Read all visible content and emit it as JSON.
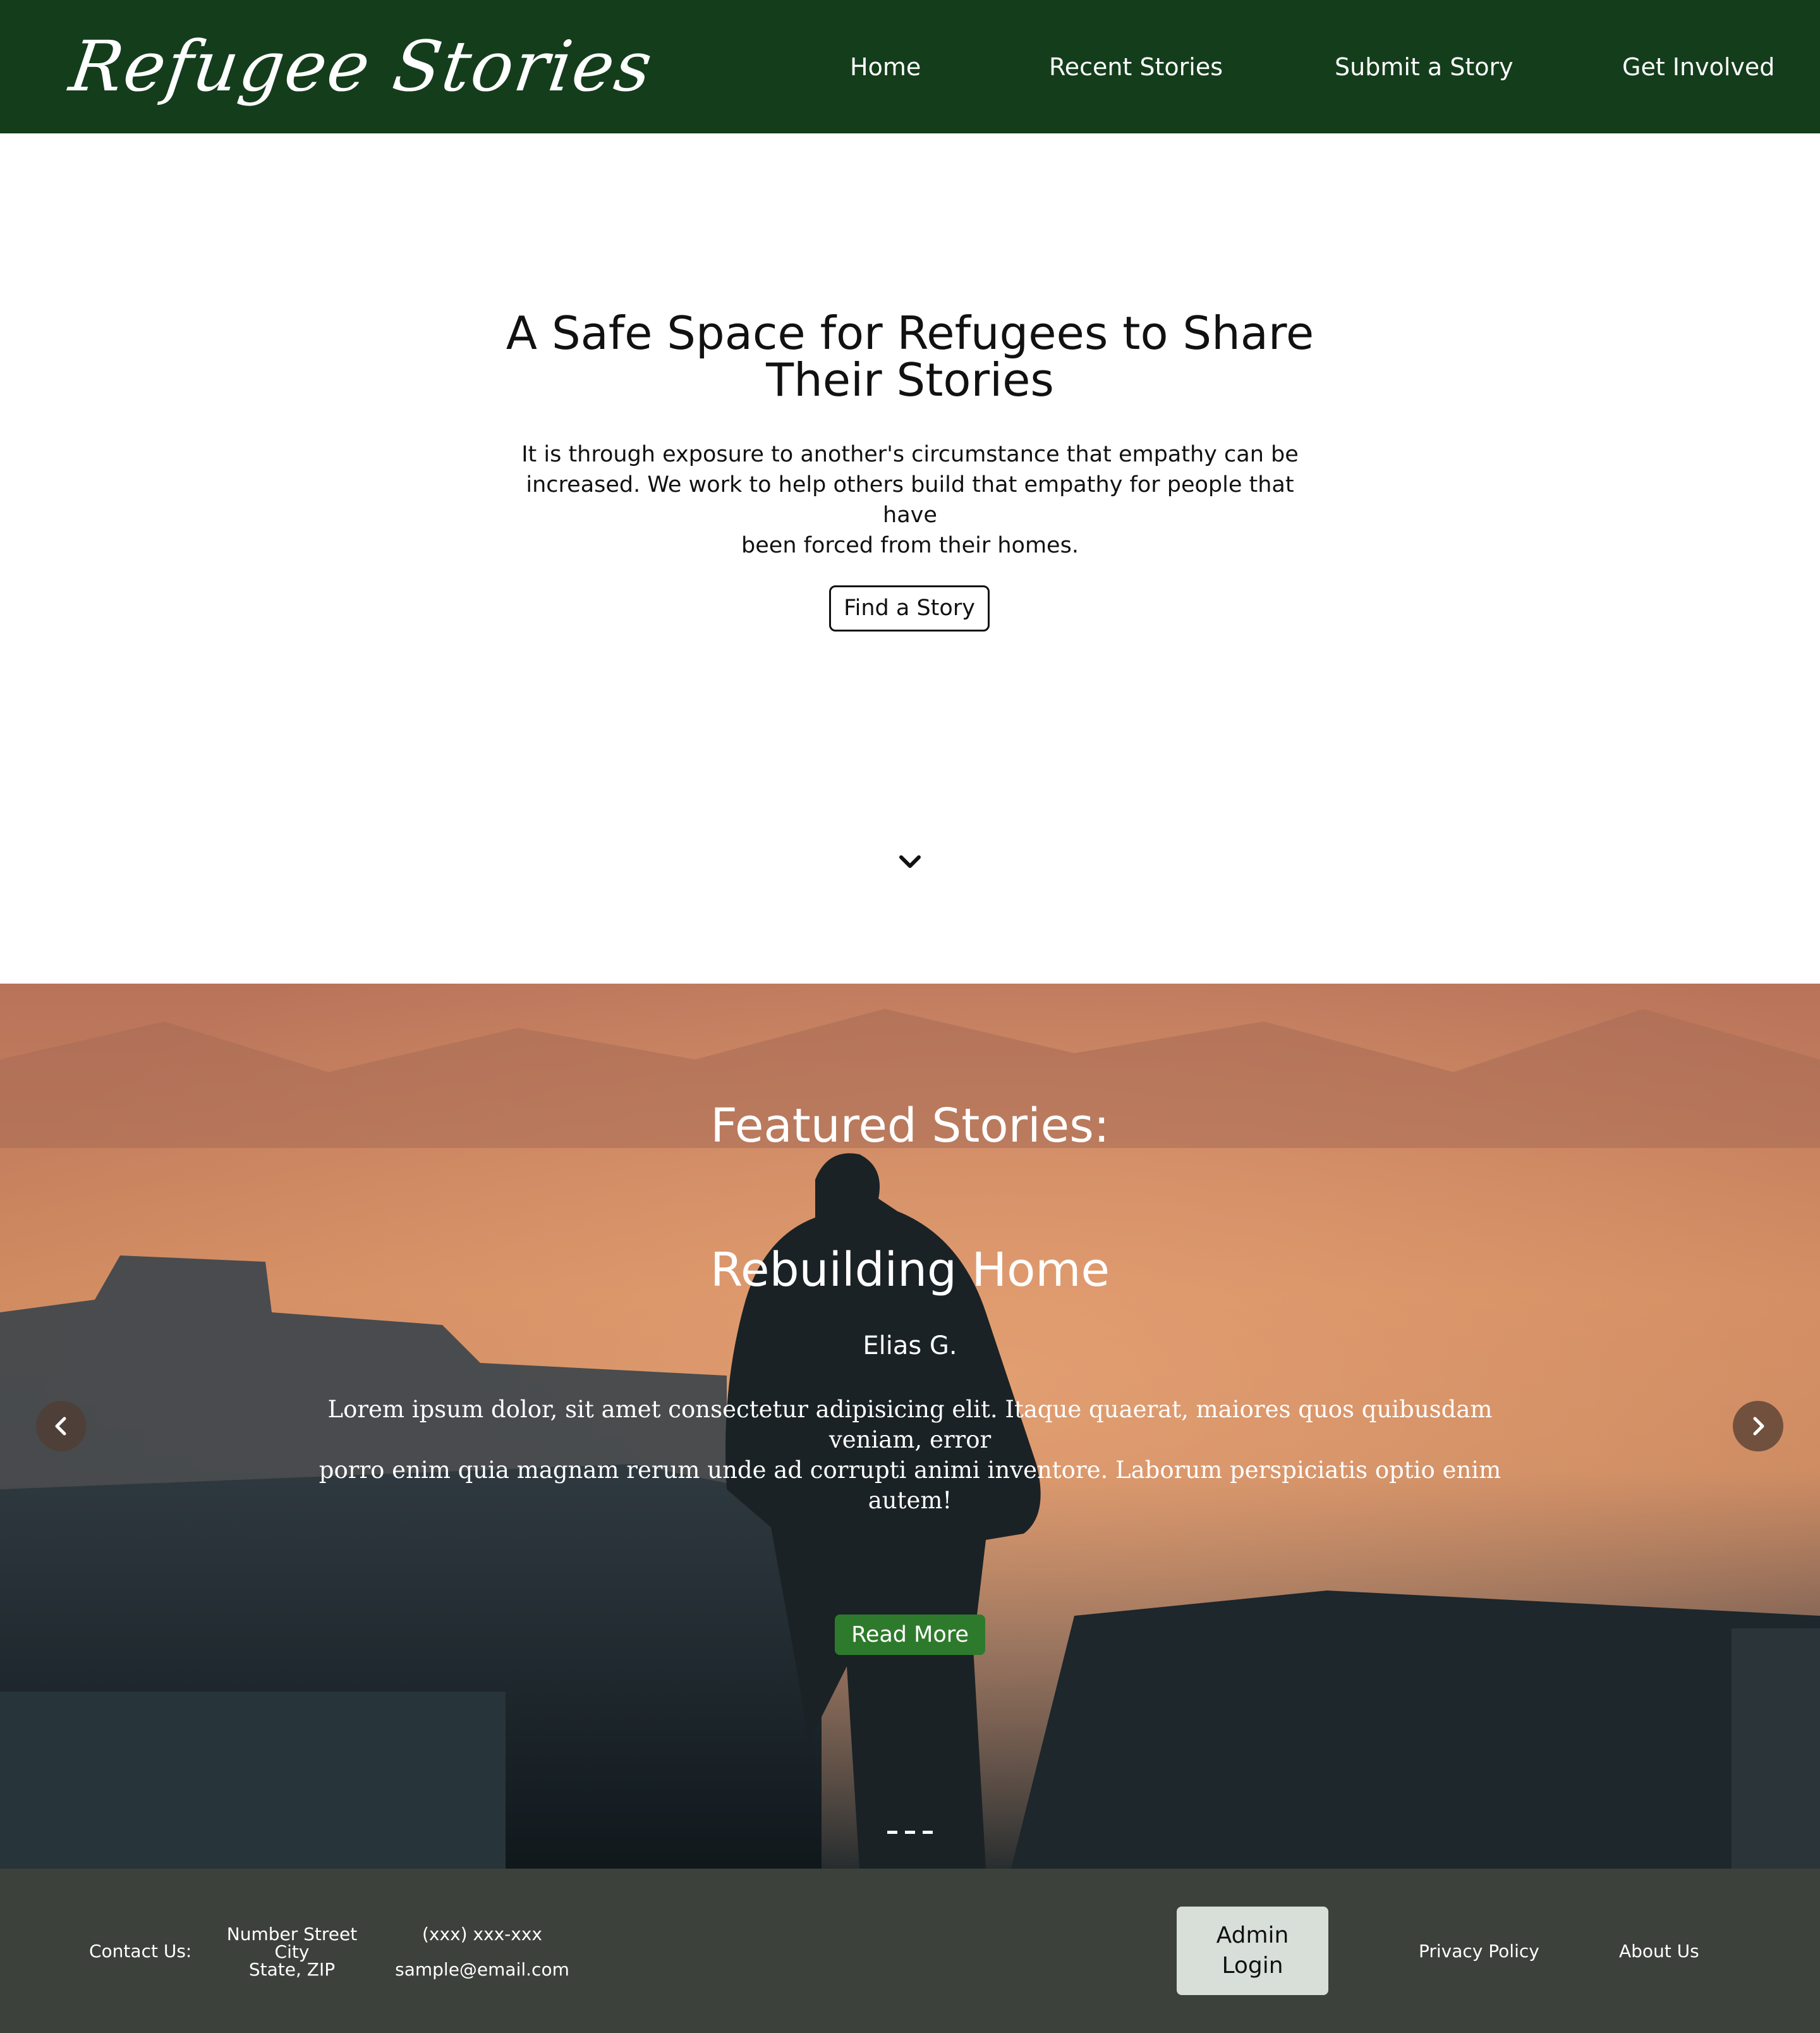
{
  "header": {
    "logo_text": "Refugee Stories",
    "nav": {
      "home": "Home",
      "recent": "Recent Stories",
      "submit": "Submit a Story",
      "involved": "Get Involved"
    }
  },
  "hero": {
    "title_line1": "A Safe Space for Refugees to Share",
    "title_line2": "Their Stories",
    "text_line1": "It is through exposure to another's circumstance that empathy can be",
    "text_line2": "increased. We work to help others build that empathy for people that have",
    "text_line3": "been forced from their homes.",
    "button": "Find a Story",
    "scroll_icon": "chevron-down-icon"
  },
  "featured": {
    "heading": "Featured Stories:",
    "story_title": "Rebuilding Home",
    "author": "Elias G.",
    "excerpt_line1": "Lorem ipsum dolor, sit amet consectetur adipisicing elit. Itaque quaerat, maiores quos quibusdam veniam, error",
    "excerpt_line2": "porro enim quia magnam rerum unde ad corrupti animi inventore. Laborum perspiciatis optio enim autem!",
    "button": "Read More",
    "prev_icon": "chevron-left-icon",
    "next_icon": "chevron-right-icon",
    "slide_count": 3
  },
  "footer": {
    "contact_label": "Contact Us:",
    "address_street": "Number Street",
    "address_city": "City",
    "address_state": "State, ZIP",
    "phone": "(xxx) xxx-xxx",
    "email": "sample@email.com",
    "admin_line1": "Admin",
    "admin_line2": "Login",
    "privacy": "Privacy Policy",
    "about": "About Us"
  },
  "colors": {
    "header_bg": "#143d1c",
    "read_more_bg": "#2e7a2c",
    "footer_bg": "#3d413c",
    "admin_button_bg": "#d7dfd8"
  }
}
